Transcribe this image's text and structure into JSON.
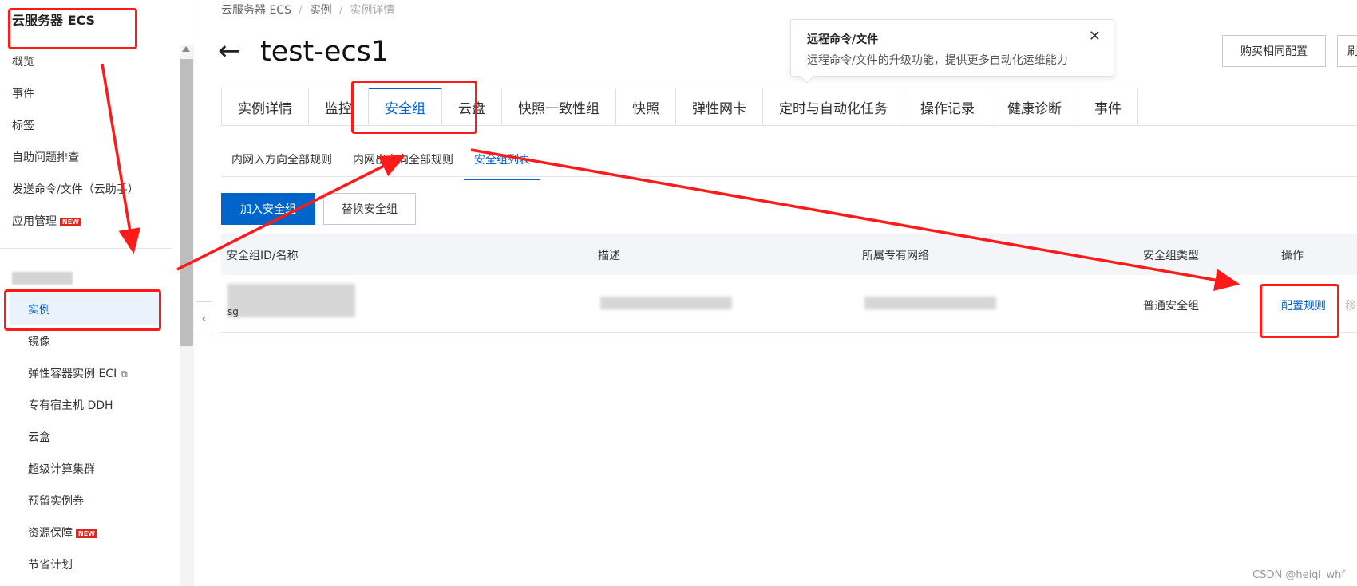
{
  "sidebar": {
    "brand": "云服务器 ECS",
    "top_items": [
      {
        "label": "概览"
      },
      {
        "label": "事件"
      },
      {
        "label": "标签"
      },
      {
        "label": "自助问题排查"
      },
      {
        "label": "发送命令/文件（云助手）"
      },
      {
        "label": "应用管理",
        "badge": "NEW"
      }
    ],
    "sub_items": [
      {
        "label": "实例",
        "active": true
      },
      {
        "label": "镜像"
      },
      {
        "label": "弹性容器实例 ECI",
        "icon": "external-link-icon"
      },
      {
        "label": "专有宿主机 DDH"
      },
      {
        "label": "云盒"
      },
      {
        "label": "超级计算集群"
      },
      {
        "label": "预留实例券"
      },
      {
        "label": "资源保障",
        "badge": "NEW"
      },
      {
        "label": "节省计划"
      }
    ]
  },
  "breadcrumb": [
    "云服务器 ECS",
    "实例",
    "实例详情"
  ],
  "page": {
    "title": "test-ecs1"
  },
  "tooltip": {
    "title": "远程命令/文件",
    "desc": "远程命令/文件的升级功能，提供更多自动化运维能力",
    "close": "✕"
  },
  "top_buttons": {
    "buy_same": "购买相同配置",
    "refresh": "刷"
  },
  "tabs": [
    "实例详情",
    "监控",
    "安全组",
    "云盘",
    "快照一致性组",
    "快照",
    "弹性网卡",
    "定时与自动化任务",
    "操作记录",
    "健康诊断",
    "事件"
  ],
  "active_tab": "安全组",
  "subtabs": [
    "内网入方向全部规则",
    "内网出方向全部规则",
    "安全组列表"
  ],
  "active_subtab": "安全组列表",
  "actions": {
    "join": "加入安全组",
    "replace": "替换安全组"
  },
  "table": {
    "columns": [
      "安全组ID/名称",
      "描述",
      "所属专有网络",
      "安全组类型",
      "操作"
    ],
    "rows": [
      {
        "id_prefix": "sg",
        "type": "普通安全组",
        "configure": "配置规则",
        "remove": "移"
      }
    ]
  },
  "watermark": "CSDN @heiqi_whf",
  "colors": {
    "accent": "#0064c8",
    "annotation": "#ff1a1a",
    "badge": "#e1251b"
  }
}
